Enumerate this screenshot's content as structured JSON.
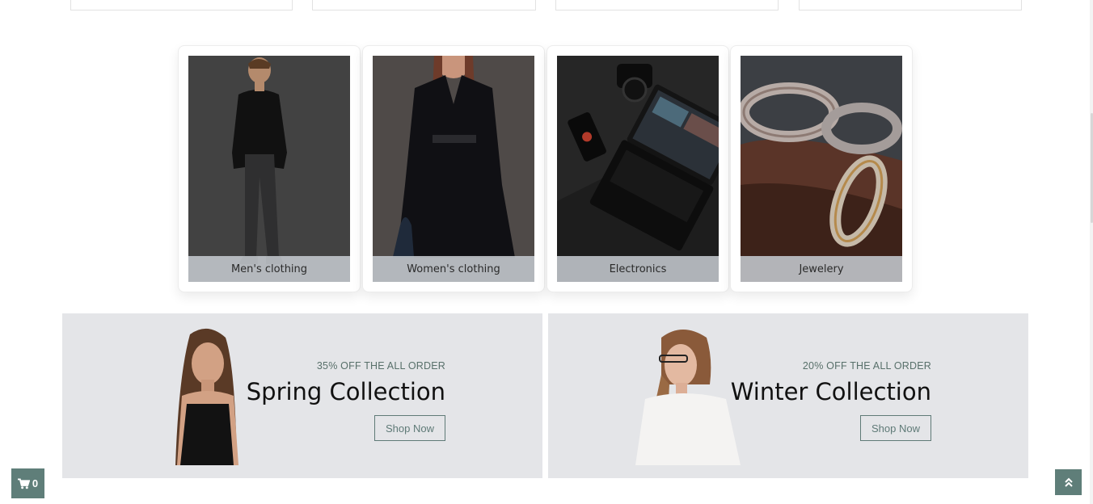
{
  "categories": [
    {
      "label": "Men's clothing",
      "icon": "mens-clothing-photo"
    },
    {
      "label": "Women's clothing",
      "icon": "womens-clothing-photo"
    },
    {
      "label": "Electronics",
      "icon": "electronics-photo"
    },
    {
      "label": "Jewelery",
      "icon": "jewelery-photo"
    }
  ],
  "banners": [
    {
      "offer": "35% OFF THE ALL ORDER",
      "title": "Spring Collection",
      "button": "Shop Now"
    },
    {
      "offer": "20% OFF THE ALL ORDER",
      "title": "Winter Collection",
      "button": "Shop Now"
    }
  ],
  "cart": {
    "count": "0",
    "icon": "cart-icon"
  },
  "scroll_top": {
    "icon": "double-chevron-up-icon"
  },
  "colors": {
    "accent": "#5f7e79",
    "banner_bg": "#e4e5e8",
    "label_bg": "#c4c8ce"
  }
}
